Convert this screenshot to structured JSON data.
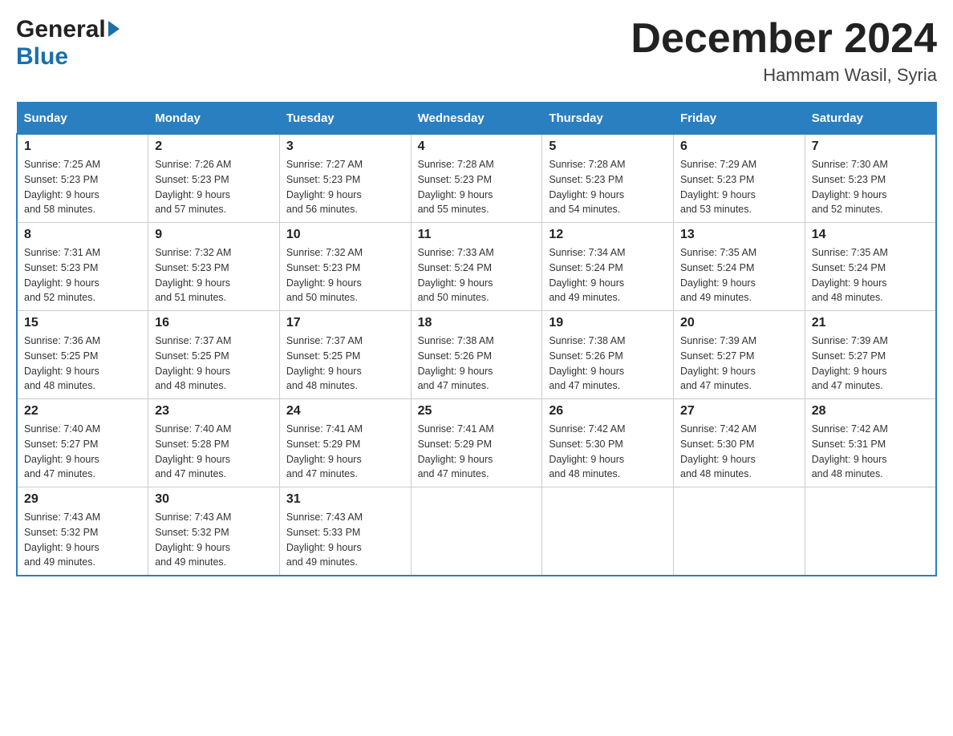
{
  "header": {
    "month_year": "December 2024",
    "location": "Hammam Wasil, Syria",
    "logo_general": "General",
    "logo_blue": "Blue"
  },
  "weekdays": [
    "Sunday",
    "Monday",
    "Tuesday",
    "Wednesday",
    "Thursday",
    "Friday",
    "Saturday"
  ],
  "weeks": [
    [
      {
        "day": "1",
        "sunrise": "7:25 AM",
        "sunset": "5:23 PM",
        "daylight": "9 hours and 58 minutes."
      },
      {
        "day": "2",
        "sunrise": "7:26 AM",
        "sunset": "5:23 PM",
        "daylight": "9 hours and 57 minutes."
      },
      {
        "day": "3",
        "sunrise": "7:27 AM",
        "sunset": "5:23 PM",
        "daylight": "9 hours and 56 minutes."
      },
      {
        "day": "4",
        "sunrise": "7:28 AM",
        "sunset": "5:23 PM",
        "daylight": "9 hours and 55 minutes."
      },
      {
        "day": "5",
        "sunrise": "7:28 AM",
        "sunset": "5:23 PM",
        "daylight": "9 hours and 54 minutes."
      },
      {
        "day": "6",
        "sunrise": "7:29 AM",
        "sunset": "5:23 PM",
        "daylight": "9 hours and 53 minutes."
      },
      {
        "day": "7",
        "sunrise": "7:30 AM",
        "sunset": "5:23 PM",
        "daylight": "9 hours and 52 minutes."
      }
    ],
    [
      {
        "day": "8",
        "sunrise": "7:31 AM",
        "sunset": "5:23 PM",
        "daylight": "9 hours and 52 minutes."
      },
      {
        "day": "9",
        "sunrise": "7:32 AM",
        "sunset": "5:23 PM",
        "daylight": "9 hours and 51 minutes."
      },
      {
        "day": "10",
        "sunrise": "7:32 AM",
        "sunset": "5:23 PM",
        "daylight": "9 hours and 50 minutes."
      },
      {
        "day": "11",
        "sunrise": "7:33 AM",
        "sunset": "5:24 PM",
        "daylight": "9 hours and 50 minutes."
      },
      {
        "day": "12",
        "sunrise": "7:34 AM",
        "sunset": "5:24 PM",
        "daylight": "9 hours and 49 minutes."
      },
      {
        "day": "13",
        "sunrise": "7:35 AM",
        "sunset": "5:24 PM",
        "daylight": "9 hours and 49 minutes."
      },
      {
        "day": "14",
        "sunrise": "7:35 AM",
        "sunset": "5:24 PM",
        "daylight": "9 hours and 48 minutes."
      }
    ],
    [
      {
        "day": "15",
        "sunrise": "7:36 AM",
        "sunset": "5:25 PM",
        "daylight": "9 hours and 48 minutes."
      },
      {
        "day": "16",
        "sunrise": "7:37 AM",
        "sunset": "5:25 PM",
        "daylight": "9 hours and 48 minutes."
      },
      {
        "day": "17",
        "sunrise": "7:37 AM",
        "sunset": "5:25 PM",
        "daylight": "9 hours and 48 minutes."
      },
      {
        "day": "18",
        "sunrise": "7:38 AM",
        "sunset": "5:26 PM",
        "daylight": "9 hours and 47 minutes."
      },
      {
        "day": "19",
        "sunrise": "7:38 AM",
        "sunset": "5:26 PM",
        "daylight": "9 hours and 47 minutes."
      },
      {
        "day": "20",
        "sunrise": "7:39 AM",
        "sunset": "5:27 PM",
        "daylight": "9 hours and 47 minutes."
      },
      {
        "day": "21",
        "sunrise": "7:39 AM",
        "sunset": "5:27 PM",
        "daylight": "9 hours and 47 minutes."
      }
    ],
    [
      {
        "day": "22",
        "sunrise": "7:40 AM",
        "sunset": "5:27 PM",
        "daylight": "9 hours and 47 minutes."
      },
      {
        "day": "23",
        "sunrise": "7:40 AM",
        "sunset": "5:28 PM",
        "daylight": "9 hours and 47 minutes."
      },
      {
        "day": "24",
        "sunrise": "7:41 AM",
        "sunset": "5:29 PM",
        "daylight": "9 hours and 47 minutes."
      },
      {
        "day": "25",
        "sunrise": "7:41 AM",
        "sunset": "5:29 PM",
        "daylight": "9 hours and 47 minutes."
      },
      {
        "day": "26",
        "sunrise": "7:42 AM",
        "sunset": "5:30 PM",
        "daylight": "9 hours and 48 minutes."
      },
      {
        "day": "27",
        "sunrise": "7:42 AM",
        "sunset": "5:30 PM",
        "daylight": "9 hours and 48 minutes."
      },
      {
        "day": "28",
        "sunrise": "7:42 AM",
        "sunset": "5:31 PM",
        "daylight": "9 hours and 48 minutes."
      }
    ],
    [
      {
        "day": "29",
        "sunrise": "7:43 AM",
        "sunset": "5:32 PM",
        "daylight": "9 hours and 49 minutes."
      },
      {
        "day": "30",
        "sunrise": "7:43 AM",
        "sunset": "5:32 PM",
        "daylight": "9 hours and 49 minutes."
      },
      {
        "day": "31",
        "sunrise": "7:43 AM",
        "sunset": "5:33 PM",
        "daylight": "9 hours and 49 minutes."
      },
      null,
      null,
      null,
      null
    ]
  ],
  "labels": {
    "sunrise": "Sunrise:",
    "sunset": "Sunset:",
    "daylight": "Daylight:"
  }
}
